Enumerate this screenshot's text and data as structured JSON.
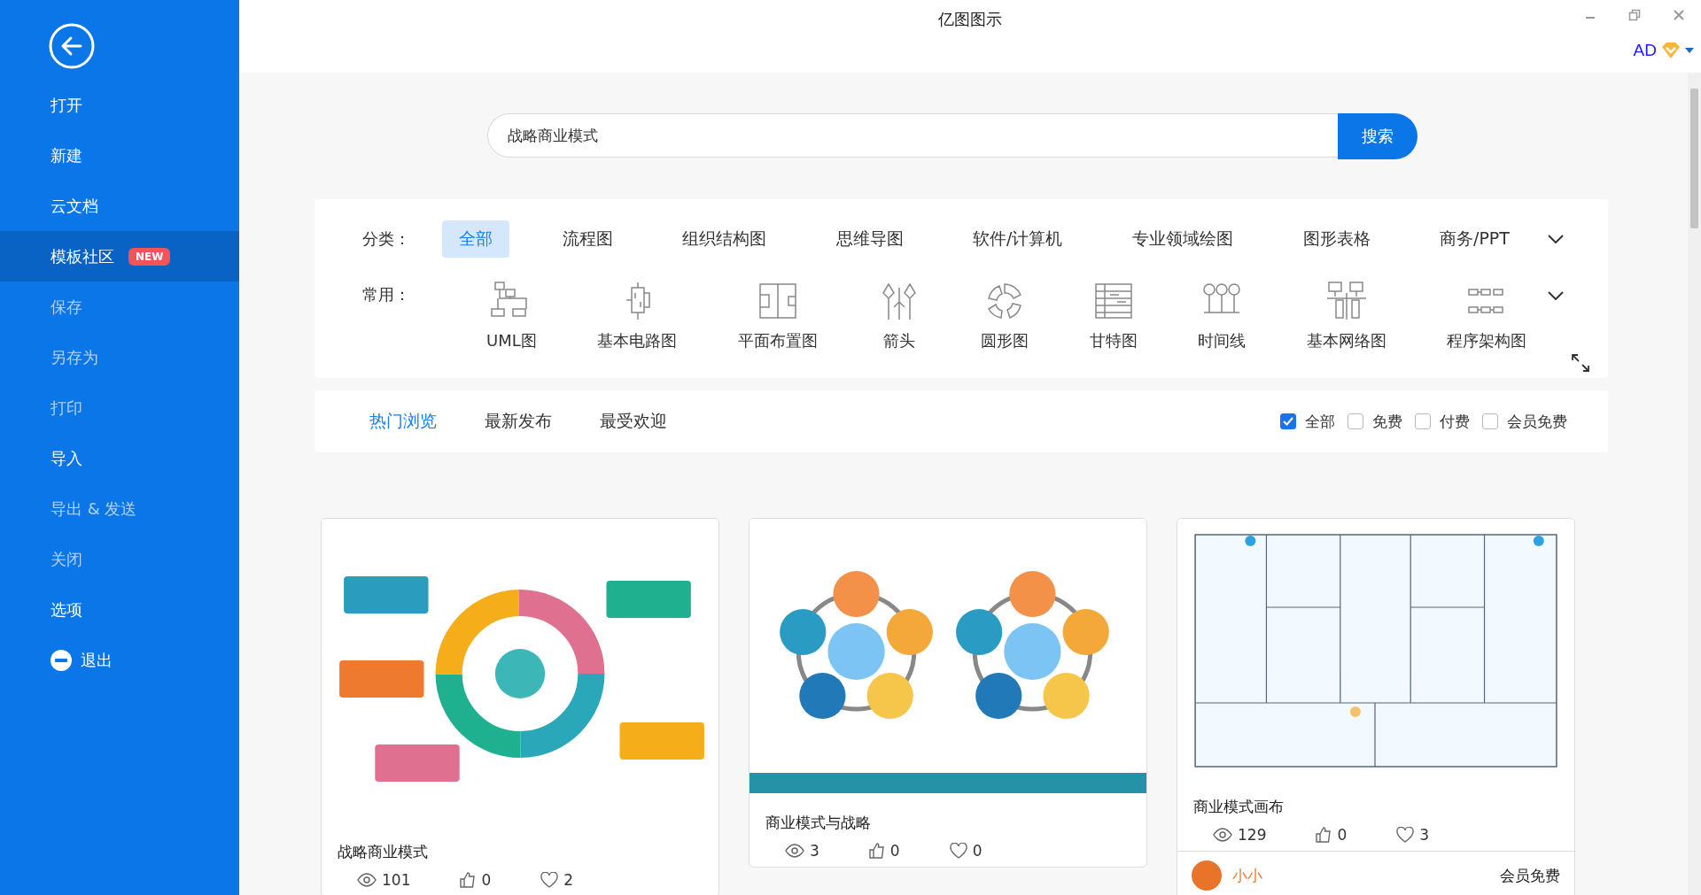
{
  "window": {
    "title": "亿图图示",
    "user": "AD"
  },
  "sidebar": {
    "items": [
      {
        "label": "打开",
        "selected": false,
        "disabled": false
      },
      {
        "label": "新建",
        "selected": false,
        "disabled": false
      },
      {
        "label": "云文档",
        "selected": false,
        "disabled": false
      },
      {
        "label": "模板社区",
        "selected": true,
        "disabled": false,
        "badge": "NEW"
      },
      {
        "label": "保存",
        "selected": false,
        "disabled": true
      },
      {
        "label": "另存为",
        "selected": false,
        "disabled": true
      },
      {
        "label": "打印",
        "selected": false,
        "disabled": true
      },
      {
        "label": "导入",
        "selected": false,
        "disabled": false
      },
      {
        "label": "导出 & 发送",
        "selected": false,
        "disabled": true
      },
      {
        "label": "关闭",
        "selected": false,
        "disabled": true
      },
      {
        "label": "选项",
        "selected": false,
        "disabled": false
      },
      {
        "label": "退出",
        "selected": false,
        "disabled": false,
        "kind": "exit"
      }
    ]
  },
  "search": {
    "value": "战略商业模式",
    "button": "搜索"
  },
  "categories": {
    "label": "分类：",
    "items": [
      {
        "label": "全部",
        "selected": true
      },
      {
        "label": "流程图",
        "selected": false
      },
      {
        "label": "组织结构图",
        "selected": false
      },
      {
        "label": "思维导图",
        "selected": false
      },
      {
        "label": "软件/计算机",
        "selected": false
      },
      {
        "label": "专业领域绘图",
        "selected": false
      },
      {
        "label": "图形表格",
        "selected": false
      },
      {
        "label": "商务/PPT",
        "selected": false
      }
    ]
  },
  "common": {
    "label": "常用：",
    "items": [
      {
        "label": "UML图"
      },
      {
        "label": "基本电路图"
      },
      {
        "label": "平面布置图"
      },
      {
        "label": "箭头"
      },
      {
        "label": "圆形图"
      },
      {
        "label": "甘特图"
      },
      {
        "label": "时间线"
      },
      {
        "label": "基本网络图"
      },
      {
        "label": "程序架构图"
      }
    ]
  },
  "sort_tabs": [
    {
      "label": "热门浏览",
      "selected": true
    },
    {
      "label": "最新发布",
      "selected": false
    },
    {
      "label": "最受欢迎",
      "selected": false
    }
  ],
  "filters": [
    {
      "label": "全部",
      "checked": true
    },
    {
      "label": "免费",
      "checked": false
    },
    {
      "label": "付费",
      "checked": false
    },
    {
      "label": "会员免费",
      "checked": false
    }
  ],
  "cards": [
    {
      "title": "战略商业模式",
      "views": "101",
      "likes": "0",
      "favorites": "2"
    },
    {
      "title": "商业模式与战略",
      "views": "3",
      "likes": "0",
      "favorites": "0"
    },
    {
      "title": "商业模式画布",
      "views": "129",
      "likes": "0",
      "favorites": "3",
      "author": "小小",
      "price": "会员免费"
    }
  ]
}
